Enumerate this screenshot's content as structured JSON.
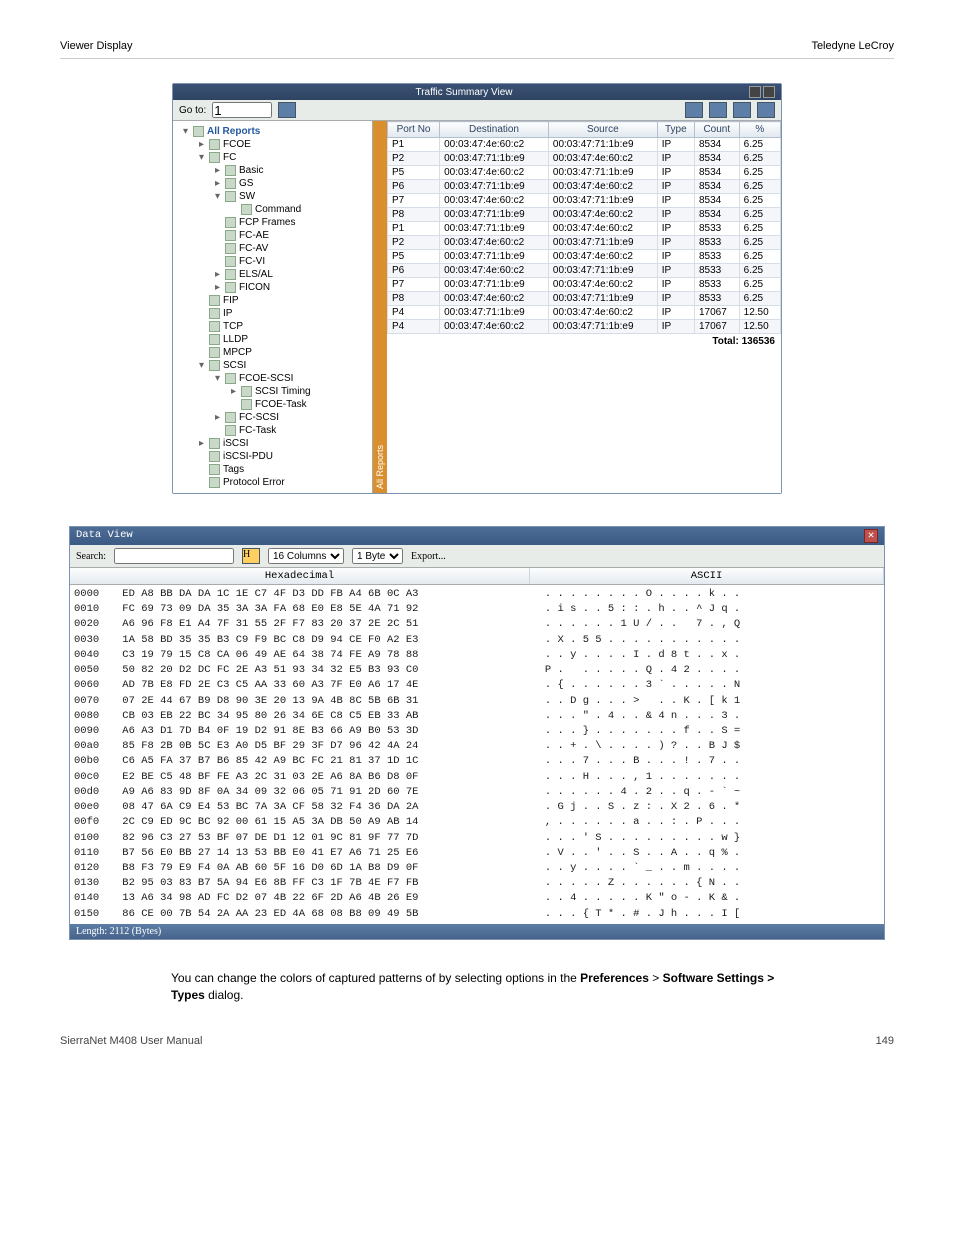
{
  "header_left": "Viewer Display",
  "header_right": "Teledyne LeCroy",
  "traffic": {
    "title": "Traffic Summary View",
    "goto_label": "Go to:",
    "goto_value": "1",
    "columns": [
      "Port No",
      "Destination",
      "Source",
      "Type",
      "Count",
      "%"
    ],
    "rows": [
      [
        "P1",
        "00:03:47:4e:60:c2",
        "00:03:47:71:1b:e9",
        "IP",
        "8534",
        "6.25"
      ],
      [
        "P2",
        "00:03:47:71:1b:e9",
        "00:03:47:4e:60:c2",
        "IP",
        "8534",
        "6.25"
      ],
      [
        "P5",
        "00:03:47:4e:60:c2",
        "00:03:47:71:1b:e9",
        "IP",
        "8534",
        "6.25"
      ],
      [
        "P6",
        "00:03:47:71:1b:e9",
        "00:03:47:4e:60:c2",
        "IP",
        "8534",
        "6.25"
      ],
      [
        "P7",
        "00:03:47:4e:60:c2",
        "00:03:47:71:1b:e9",
        "IP",
        "8534",
        "6.25"
      ],
      [
        "P8",
        "00:03:47:71:1b:e9",
        "00:03:47:4e:60:c2",
        "IP",
        "8534",
        "6.25"
      ],
      [
        "P1",
        "00:03:47:71:1b:e9",
        "00:03:47:4e:60:c2",
        "IP",
        "8533",
        "6.25"
      ],
      [
        "P2",
        "00:03:47:4e:60:c2",
        "00:03:47:71:1b:e9",
        "IP",
        "8533",
        "6.25"
      ],
      [
        "P5",
        "00:03:47:71:1b:e9",
        "00:03:47:4e:60:c2",
        "IP",
        "8533",
        "6.25"
      ],
      [
        "P6",
        "00:03:47:4e:60:c2",
        "00:03:47:71:1b:e9",
        "IP",
        "8533",
        "6.25"
      ],
      [
        "P7",
        "00:03:47:71:1b:e9",
        "00:03:47:4e:60:c2",
        "IP",
        "8533",
        "6.25"
      ],
      [
        "P8",
        "00:03:47:4e:60:c2",
        "00:03:47:71:1b:e9",
        "IP",
        "8533",
        "6.25"
      ],
      [
        "P4",
        "00:03:47:71:1b:e9",
        "00:03:47:4e:60:c2",
        "IP",
        "17067",
        "12.50"
      ],
      [
        "P4",
        "00:03:47:4e:60:c2",
        "00:03:47:71:1b:e9",
        "IP",
        "17067",
        "12.50"
      ]
    ],
    "total_label": "Total:",
    "total_value": "136536",
    "side_tab": "All Reports"
  },
  "tree": {
    "root": "All Reports",
    "n_fcoe": "FCOE",
    "n_fc": "FC",
    "n_basic": "Basic",
    "n_gs": "GS",
    "n_sw": "SW",
    "n_command": "Command",
    "n_fcpframes": "FCP Frames",
    "n_fcae": "FC-AE",
    "n_fcav": "FC-AV",
    "n_fcvi": "FC-VI",
    "n_elsal": "ELS/AL",
    "n_ficon": "FICON",
    "n_fip": "FIP",
    "n_ip": "IP",
    "n_tcp": "TCP",
    "n_lldp": "LLDP",
    "n_mpcp": "MPCP",
    "n_scsi": "SCSI",
    "n_fcoescsi": "FCOE-SCSI",
    "n_scsitiming": "SCSI Timing",
    "n_fcoetask": "FCOE-Task",
    "n_fcscsi": "FC-SCSI",
    "n_fctask": "FC-Task",
    "n_iscsi": "iSCSI",
    "n_iscsipdu": "iSCSI-PDU",
    "n_tags": "Tags",
    "n_protoerr": "Protocol Error"
  },
  "dataview": {
    "title": "Data View",
    "search_label": "Search:",
    "search_value": "",
    "columns_val": "16 Columns",
    "bytes_val": "1 Byte",
    "export_label": "Export...",
    "header_hex": "Hexadecimal",
    "header_ascii": "ASCII",
    "status": "Length: 2112 (Bytes)",
    "rows": [
      [
        "0000",
        "ED A8 BB DA DA 1C 1E C7 4F D3 DD FB A4 6B 0C A3",
        ". . . . . . . . O . . . . k . ."
      ],
      [
        "0010",
        "FC 69 73 09 DA 35 3A 3A FA 68 E0 E8 5E 4A 71 92",
        ". i s . . 5 : : . h . . ^ J q ."
      ],
      [
        "0020",
        "A6 96 F8 E1 A4 7F 31 55 2F F7 83 20 37 2E 2C 51",
        ". . . . . . 1 U / . .   7 . , Q"
      ],
      [
        "0030",
        "1A 58 BD 35 35 B3 C9 F9 BC C8 D9 94 CE F0 A2 E3",
        ". X . 5 5 . . . . . . . . . . ."
      ],
      [
        "0040",
        "C3 19 79 15 C8 CA 06 49 AE 64 38 74 FE A9 78 88",
        ". . y . . . . I . d 8 t . . x ."
      ],
      [
        "0050",
        "50 82 20 D2 DC FC 2E A3 51 93 34 32 E5 B3 93 C0",
        "P .   . . . . . Q . 4 2 . . . ."
      ],
      [
        "0060",
        "AD 7B E8 FD 2E C3 C5 AA 33 60 A3 7F E0 A6 17 4E",
        ". { . . . . . . 3 ` . . . . . N"
      ],
      [
        "0070",
        "07 2E 44 67 B9 D8 90 3E 20 13 9A 4B 8C 5B 6B 31",
        ". . D g . . . >   . . K . [ k 1"
      ],
      [
        "0080",
        "CB 03 EB 22 BC 34 95 80 26 34 6E C8 C5 EB 33 AB",
        ". . . \" . 4 . . & 4 n . . . 3 ."
      ],
      [
        "0090",
        "A6 A3 D1 7D B4 0F 19 D2 91 8E B3 66 A9 B0 53 3D",
        ". . . } . . . . . . . f . . S ="
      ],
      [
        "00a0",
        "85 F8 2B 0B 5C E3 A0 D5 BF 29 3F D7 96 42 4A 24",
        ". . + . \\ . . . . ) ? . . B J $"
      ],
      [
        "00b0",
        "C6 A5 FA 37 B7 B6 85 42 A9 BC FC 21 81 37 1D 1C",
        ". . . 7 . . . B . . . ! . 7 . ."
      ],
      [
        "00c0",
        "E2 BE C5 48 BF FE A3 2C 31 03 2E A6 8A B6 D8 0F",
        ". . . H . . . , 1 . . . . . . ."
      ],
      [
        "00d0",
        "A9 A6 83 9D 8F 0A 34 09 32 06 05 71 91 2D 60 7E",
        ". . . . . . 4 . 2 . . q . - ` ~"
      ],
      [
        "00e0",
        "08 47 6A C9 E4 53 BC 7A 3A CF 58 32 F4 36 DA 2A",
        ". G j . . S . z : . X 2 . 6 . *"
      ],
      [
        "00f0",
        "2C C9 ED 9C BC 92 00 61 15 A5 3A DB 50 A9 AB 14",
        ", . . . . . . a . . : . P . . ."
      ],
      [
        "0100",
        "82 96 C3 27 53 BF 07 DE D1 12 01 9C 81 9F 77 7D",
        ". . . ' S . . . . . . . . . w }"
      ],
      [
        "0110",
        "B7 56 E0 BB 27 14 13 53 BB E0 41 E7 A6 71 25 E6",
        ". V . . ' . . S . . A . . q % ."
      ],
      [
        "0120",
        "B8 F3 79 E9 F4 0A AB 60 5F 16 D0 6D 1A B8 D9 0F",
        ". . y . . . . ` _ . . m . . . ."
      ],
      [
        "0130",
        "B2 95 03 83 B7 5A 94 E6 8B FF C3 1F 7B 4E F7 FB",
        ". . . . . Z . . . . . . { N . ."
      ],
      [
        "0140",
        "13 A6 34 98 AD FC D2 07 4B 22 6F 2D A6 4B 26 E9",
        ". . 4 . . . . . K \" o - . K & ."
      ],
      [
        "0150",
        "86 CE 00 7B 54 2A AA 23 ED 4A 68 08 B8 09 49 5B",
        ". . . { T * . # . J h . . . I ["
      ]
    ]
  },
  "note_prefix": "You can change the colors of captured patterns of by selecting options in the ",
  "note_bold1": "Preferences",
  "note_mid": " > ",
  "note_bold2": "Software Settings > Types",
  "note_suffix": " dialog.",
  "footer_left": "SierraNet M408 User Manual",
  "footer_right": "149"
}
